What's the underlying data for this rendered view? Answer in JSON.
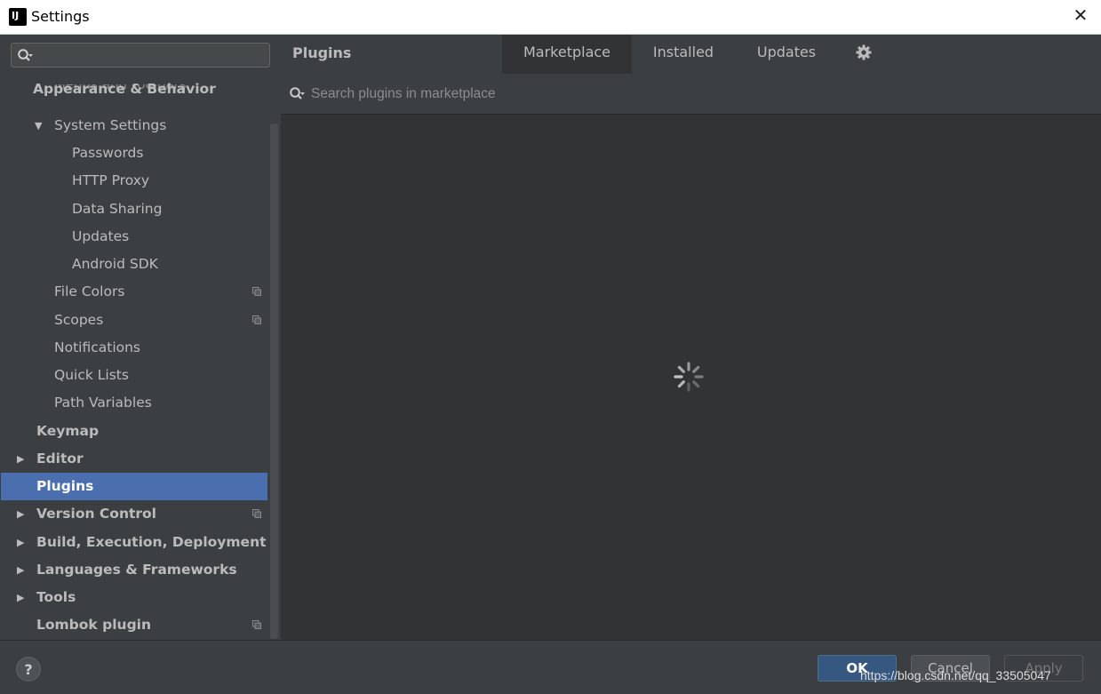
{
  "window": {
    "title": "Settings",
    "close_glyph": "✕",
    "app_icon_text": "IJ"
  },
  "sidebar": {
    "search": {
      "value": "",
      "placeholder": ""
    },
    "ghost_text": "Menus and Toolbars",
    "items": [
      {
        "label": "Appearance & Behavior",
        "bold": true,
        "arrow": "",
        "copy": false
      },
      {
        "label": "System Settings",
        "bold": false,
        "arrow": "▼",
        "copy": false
      },
      {
        "label": "Passwords",
        "bold": false,
        "arrow": "",
        "copy": false
      },
      {
        "label": "HTTP Proxy",
        "bold": false,
        "arrow": "",
        "copy": false
      },
      {
        "label": "Data Sharing",
        "bold": false,
        "arrow": "",
        "copy": false
      },
      {
        "label": "Updates",
        "bold": false,
        "arrow": "",
        "copy": false
      },
      {
        "label": "Android SDK",
        "bold": false,
        "arrow": "",
        "copy": false
      },
      {
        "label": "File Colors",
        "bold": false,
        "arrow": "",
        "copy": true
      },
      {
        "label": "Scopes",
        "bold": false,
        "arrow": "",
        "copy": true
      },
      {
        "label": "Notifications",
        "bold": false,
        "arrow": "",
        "copy": false
      },
      {
        "label": "Quick Lists",
        "bold": false,
        "arrow": "",
        "copy": false
      },
      {
        "label": "Path Variables",
        "bold": false,
        "arrow": "",
        "copy": false
      },
      {
        "label": "Keymap",
        "bold": true,
        "arrow": "",
        "copy": false
      },
      {
        "label": "Editor",
        "bold": true,
        "arrow": "▶",
        "copy": false
      },
      {
        "label": "Plugins",
        "bold": true,
        "arrow": "",
        "copy": false,
        "selected": true
      },
      {
        "label": "Version Control",
        "bold": true,
        "arrow": "▶",
        "copy": true
      },
      {
        "label": "Build, Execution, Deployment",
        "bold": true,
        "arrow": "▶",
        "copy": false
      },
      {
        "label": "Languages & Frameworks",
        "bold": true,
        "arrow": "▶",
        "copy": false
      },
      {
        "label": "Tools",
        "bold": true,
        "arrow": "▶",
        "copy": false
      },
      {
        "label": "Lombok plugin",
        "bold": true,
        "arrow": "",
        "copy": true
      }
    ]
  },
  "plugins": {
    "title": "Plugins",
    "tabs": [
      {
        "label": "Marketplace",
        "active": true
      },
      {
        "label": "Installed",
        "active": false
      },
      {
        "label": "Updates",
        "active": false
      }
    ],
    "settings_icon": "gear-icon",
    "search": {
      "value": "",
      "placeholder": "Search plugins in marketplace"
    },
    "loading_icon": "spinner-icon"
  },
  "footer": {
    "help_label": "?",
    "ok_label": "OK",
    "cancel_label": "Cancel",
    "apply_label": "Apply",
    "watermark": "https://blog.csdn.net/qq_33505047"
  },
  "colors": {
    "background": "#3c3f41",
    "content": "#313335",
    "selection": "#4b6eaf",
    "primary_button": "#365880",
    "text": "#bbbbbb"
  }
}
